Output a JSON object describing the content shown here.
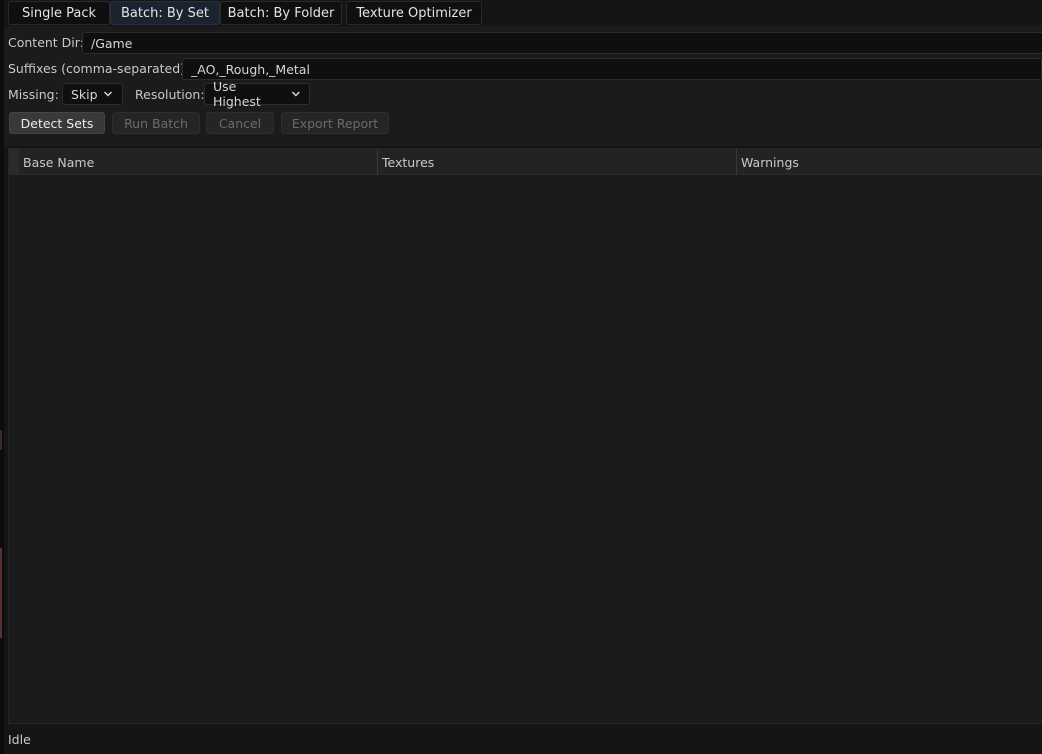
{
  "tabs": [
    {
      "label": "Single Pack",
      "active": false
    },
    {
      "label": "Batch: By Set",
      "active": true
    },
    {
      "label": "Batch: By Folder",
      "active": false
    },
    {
      "label": "Texture Optimizer",
      "active": false
    }
  ],
  "form": {
    "content_dir": {
      "label": "Content Dir:",
      "value": "/Game"
    },
    "suffixes": {
      "label": "Suffixes (comma-separated):",
      "value": "_AO,_Rough,_Metal"
    },
    "missing": {
      "label": "Missing:",
      "selected": "Skip",
      "icon": "chevron-down-icon"
    },
    "resolution": {
      "label": "Resolution:",
      "selected": "Use Highest",
      "icon": "chevron-down-icon"
    }
  },
  "actions": {
    "detect_sets": {
      "label": "Detect Sets",
      "enabled": true
    },
    "run_batch": {
      "label": "Run Batch",
      "enabled": false
    },
    "cancel": {
      "label": "Cancel",
      "enabled": false
    },
    "export_report": {
      "label": "Export Report",
      "enabled": false
    }
  },
  "table": {
    "columns": [
      "Base Name",
      "Textures",
      "Warnings"
    ],
    "rows": []
  },
  "status": {
    "text": "Idle"
  },
  "colors": {
    "background": "#151515",
    "panel": "#1b1b1b",
    "active_tab": "#1c2330",
    "field": "#0f0f0f",
    "primary_button": "#393939",
    "disabled_text": "#6b6b6b"
  }
}
